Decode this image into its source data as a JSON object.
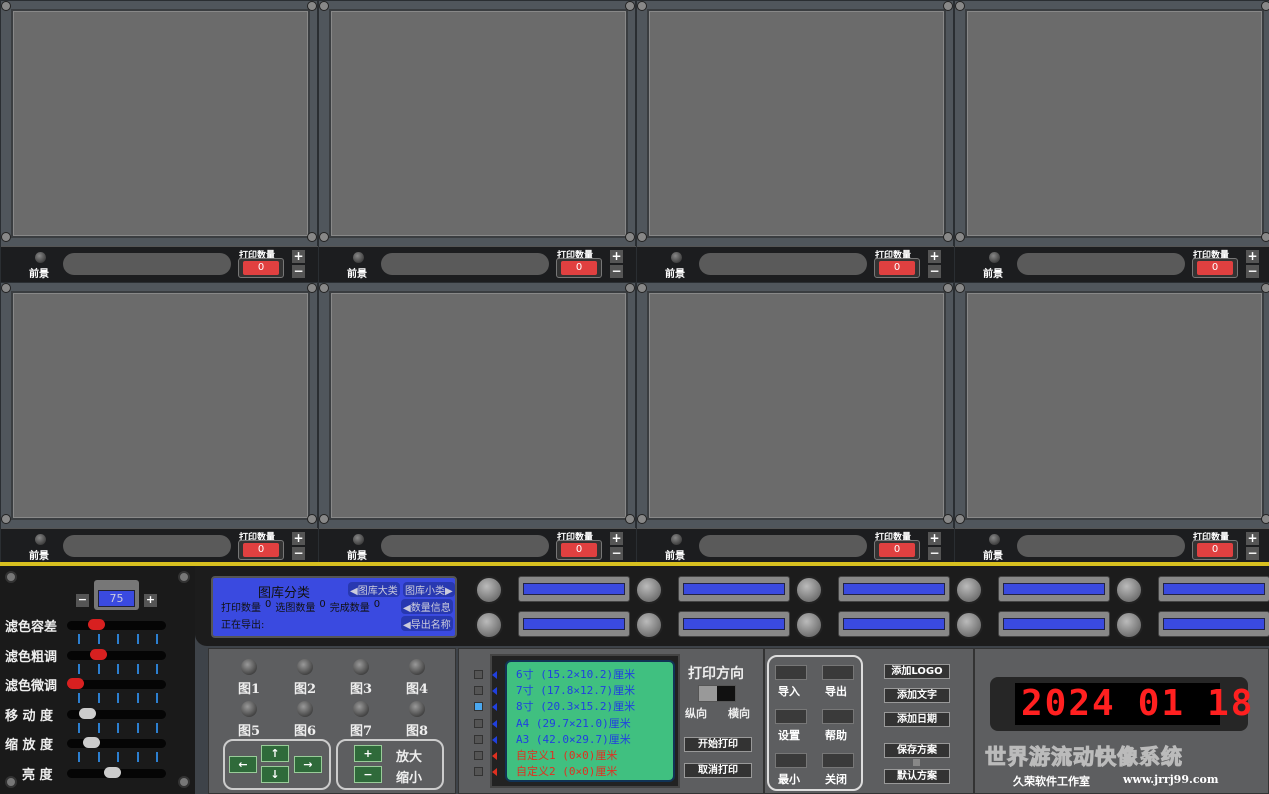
{
  "panels": [
    {
      "foreground_label": "前景",
      "print_qty_label": "打印数量",
      "print_qty": "0"
    },
    {
      "foreground_label": "前景",
      "print_qty_label": "打印数量",
      "print_qty": "0"
    },
    {
      "foreground_label": "前景",
      "print_qty_label": "打印数量",
      "print_qty": "0"
    },
    {
      "foreground_label": "前景",
      "print_qty_label": "打印数量",
      "print_qty": "0"
    },
    {
      "foreground_label": "前景",
      "print_qty_label": "打印数量",
      "print_qty": "0"
    },
    {
      "foreground_label": "前景",
      "print_qty_label": "打印数量",
      "print_qty": "0"
    },
    {
      "foreground_label": "前景",
      "print_qty_label": "打印数量",
      "print_qty": "0"
    },
    {
      "foreground_label": "前景",
      "print_qty_label": "打印数量",
      "print_qty": "0"
    }
  ],
  "plus": "+",
  "minus": "−",
  "adjust": {
    "value": "75",
    "sliders": [
      {
        "label": "滤色容差",
        "pos": 0.25,
        "color": "red"
      },
      {
        "label": "滤色粗调",
        "pos": 0.28,
        "color": "red"
      },
      {
        "label": "滤色微调",
        "pos": 0.0,
        "color": "red"
      },
      {
        "label": "移 动 度",
        "pos": 0.15,
        "color": "white"
      },
      {
        "label": "缩 放 度",
        "pos": 0.2,
        "color": "white"
      },
      {
        "label": "亮 度",
        "pos": 0.45,
        "color": "white"
      }
    ]
  },
  "info": {
    "title": "图库分类",
    "btn_major": "◀图库大类",
    "btn_minor": "图库小类▶",
    "print_count_label": "打印数量",
    "print_count": "0",
    "select_count_label": "选图数量",
    "select_count": "0",
    "done_count_label": "完成数量",
    "done_count": "0",
    "btn_count_info": "◀数量信息",
    "exporting_label": "正在导出:",
    "btn_export_name": "◀导出名称"
  },
  "images": [
    "图1",
    "图2",
    "图3",
    "图4",
    "图5",
    "图6",
    "图7",
    "图8"
  ],
  "nav": {
    "left": "←",
    "up": "↑",
    "down": "↓",
    "right": "→",
    "zoom_in": "+",
    "zoom_out": "−",
    "zoom_in_label": "放大",
    "zoom_out_label": "缩小"
  },
  "sizes": [
    {
      "label": "6寸 (15.2×10.2)厘米",
      "color": "#2040e0",
      "selected": false
    },
    {
      "label": "7寸 (17.8×12.7)厘米",
      "color": "#2040e0",
      "selected": false
    },
    {
      "label": "8寸 (20.3×15.2)厘米",
      "color": "#2040e0",
      "selected": true
    },
    {
      "label": "A4 (29.7×21.0)厘米",
      "color": "#2040e0",
      "selected": false
    },
    {
      "label": "A3 (42.0×29.7)厘米",
      "color": "#2040e0",
      "selected": false
    },
    {
      "label": "自定义1 (0×0)厘米",
      "color": "#e03020",
      "selected": false
    },
    {
      "label": "自定义2 (0×0)厘米",
      "color": "#e03020",
      "selected": false
    }
  ],
  "print": {
    "direction_label": "打印方向",
    "portrait": "纵向",
    "landscape": "横向",
    "start": "开始打印",
    "cancel": "取消打印"
  },
  "functions": [
    "导入",
    "导出",
    "设置",
    "帮助",
    "最小",
    "关闭"
  ],
  "extras": {
    "add_logo": "添加LOGO",
    "add_text": "添加文字",
    "add_date": "添加日期",
    "save_scheme": "保存方案",
    "default_scheme": "默认方案"
  },
  "date_display": {
    "year": "2024",
    "month": "01",
    "day": "18"
  },
  "brand": {
    "title": "世界游流动快像系统",
    "studio": "久荣软件工作室",
    "url": "www.jrrj99.com"
  }
}
